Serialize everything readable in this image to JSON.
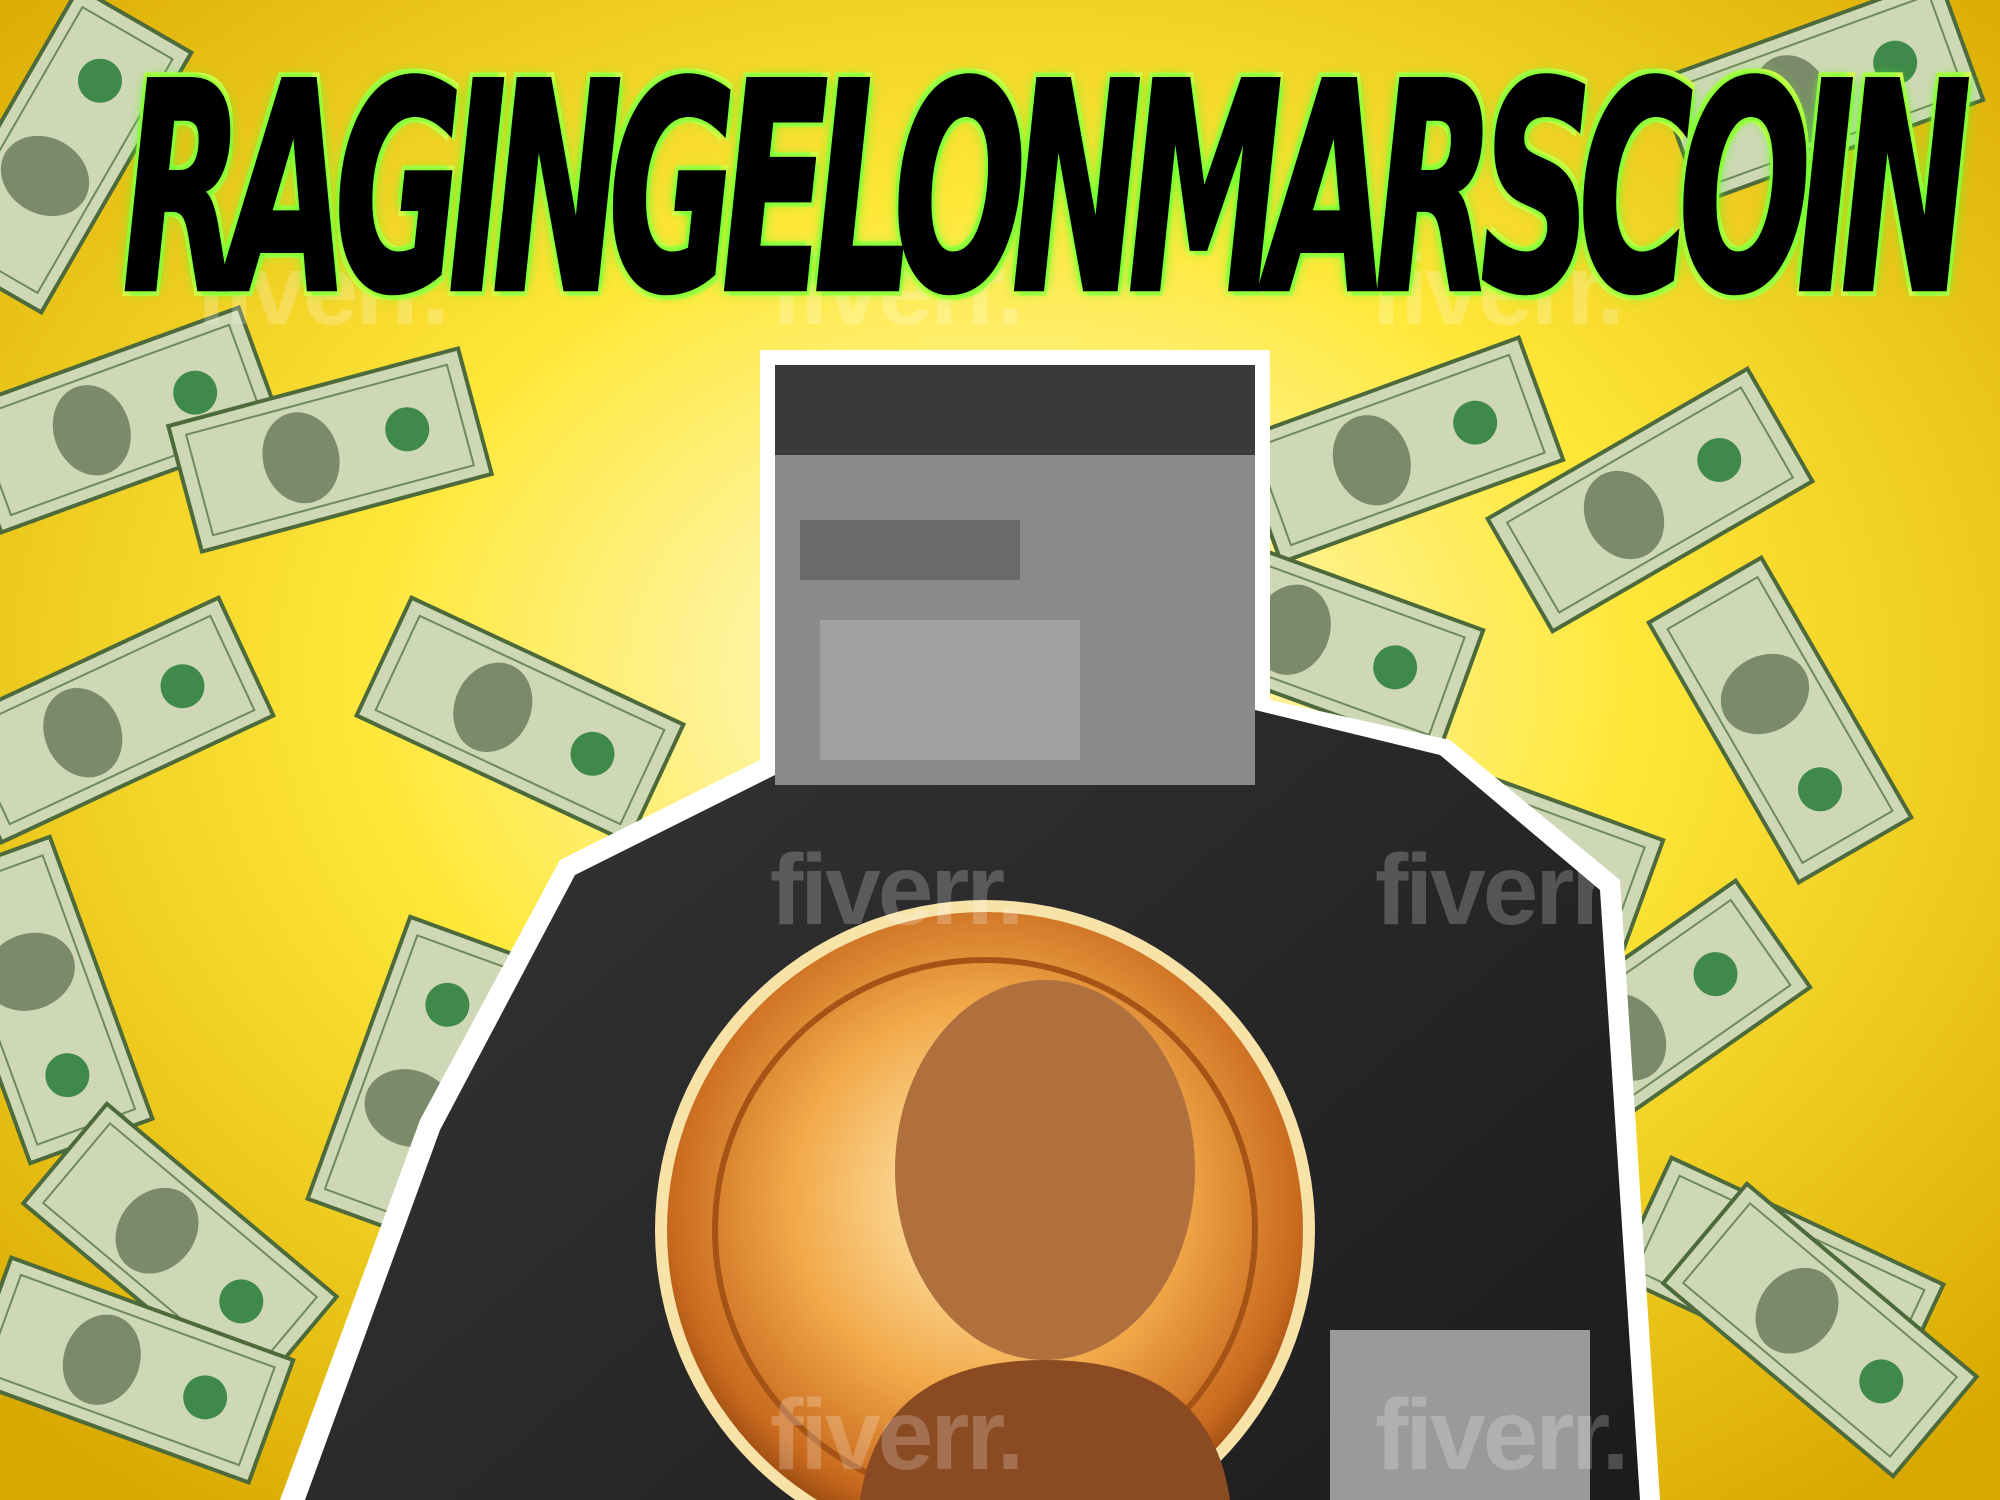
{
  "poster": {
    "title": "RAGINGELONMARSCOIN",
    "watermark": "fiverr.",
    "colors": {
      "background": "#f3d400",
      "title_text": "#000000",
      "title_glow": "#5dff2a",
      "banknote": "#c9d2b0",
      "silhouette_outline": "#ffffff",
      "coin": "#e39a3c"
    }
  }
}
